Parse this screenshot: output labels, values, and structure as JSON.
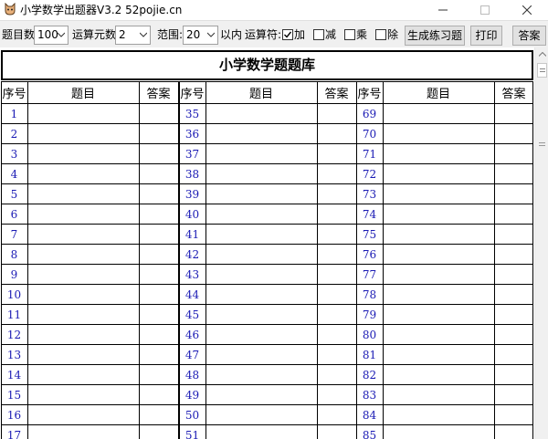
{
  "window": {
    "title": "小学数学出题器V3.2 52pojie.cn",
    "icon": "cat-app-icon",
    "controls": {
      "minimize": "—",
      "maximize": "☐",
      "close": "✕"
    }
  },
  "toolbar": {
    "count_label": "题目数:",
    "count_value": "100",
    "operands_label": "运算元数:",
    "operands_value": "2",
    "range_label": "范围:",
    "range_value": "20",
    "range_suffix": "以内",
    "operators_label": "运算符:",
    "ops": [
      {
        "label": "加",
        "checked": true
      },
      {
        "label": "减",
        "checked": false
      },
      {
        "label": "乘",
        "checked": false
      },
      {
        "label": "除",
        "checked": false
      }
    ],
    "generate_label": "生成练习题",
    "print_label": "打印",
    "answer_label": "答案"
  },
  "sheet": {
    "title": "小学数学题题库",
    "headers": [
      "序号",
      "题目",
      "答案"
    ],
    "columns": [
      {
        "numbers": [
          "1",
          "2",
          "3",
          "4",
          "5",
          "6",
          "7",
          "8",
          "9",
          "10",
          "11",
          "12",
          "13",
          "14",
          "15",
          "16",
          "17"
        ]
      },
      {
        "numbers": [
          "35",
          "36",
          "37",
          "38",
          "39",
          "40",
          "41",
          "42",
          "43",
          "44",
          "45",
          "46",
          "47",
          "48",
          "49",
          "50",
          "51"
        ]
      },
      {
        "numbers": [
          "69",
          "70",
          "71",
          "72",
          "73",
          "74",
          "75",
          "76",
          "77",
          "78",
          "79",
          "80",
          "81",
          "82",
          "83",
          "84",
          "85"
        ]
      }
    ]
  },
  "colors": {
    "number_text": "#1a1ab4",
    "toolbar_bg": "#f0f0f0",
    "grid": "#000000"
  }
}
